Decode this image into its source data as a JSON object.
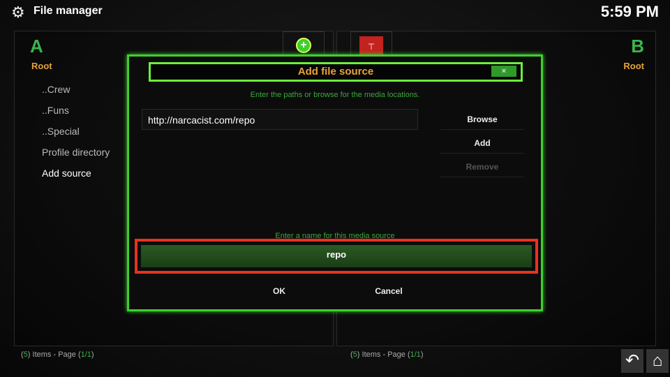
{
  "header": {
    "title": "File manager",
    "clock": "5:59 PM",
    "icon": "gear-icon"
  },
  "left_pane": {
    "letter": "A",
    "path": "Root",
    "items": [
      "..Crew",
      "..Funs",
      "..Special",
      "Profile directory",
      "Add source"
    ],
    "footer": {
      "count": "5",
      "page": "1/1",
      "items_label": "Items - Page"
    }
  },
  "right_pane": {
    "letter": "B",
    "path": "Root",
    "footer": {
      "count": "5",
      "page": "1/1",
      "items_label": "Items - Page"
    }
  },
  "dialog": {
    "title": "Add file source",
    "close": "×",
    "paths_hint": "Enter the paths or browse for the media locations.",
    "path_value": "http://narcacist.com/repo",
    "browse": "Browse",
    "add": "Add",
    "remove": "Remove",
    "name_hint": "Enter a name for this media source",
    "name_value": "repo",
    "ok": "OK",
    "cancel": "Cancel"
  },
  "colors": {
    "accent": "#3fcf2f",
    "title": "#e9a23b",
    "highlight": "#e8321e"
  }
}
